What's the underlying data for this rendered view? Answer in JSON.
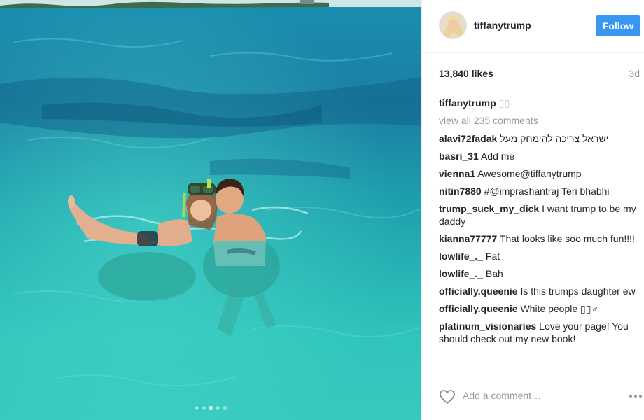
{
  "post": {
    "photo": {
      "alt": "",
      "carousel_dots": 5,
      "active_dot": 3
    }
  },
  "header": {
    "username": "tiffanytrump",
    "follow_label": "Follow"
  },
  "meta": {
    "likes": "13,840 likes",
    "age": "3d"
  },
  "caption": {
    "username": "tiffanytrump",
    "text": "▯▯"
  },
  "view_all_comments": "view all 235 comments",
  "comments": [
    {
      "user": "alavi72fadak",
      "text": "ישראל צריכה להימחק מעל"
    },
    {
      "user": "basri_31",
      "text": "Add me"
    },
    {
      "user": "vienna1",
      "text": "Awesome@tiffanytrump"
    },
    {
      "user": "nitin7880",
      "text": "#@imprashantraj Teri bhabhi"
    },
    {
      "user": "trump_suck_my_dick",
      "text": "I want trump to be my daddy"
    },
    {
      "user": "kianna77777",
      "text": "That looks like soo much fun!!!!"
    },
    {
      "user": "lowlife_._",
      "text": "Fat"
    },
    {
      "user": "lowlife_._",
      "text": "Bah"
    },
    {
      "user": "officially.queenie",
      "text": "Is this trumps daughter ew"
    },
    {
      "user": "officially.queenie",
      "text": "White people ▯▯♂"
    },
    {
      "user": "platinum_visionaries",
      "text": "Love your page! You should check out my new book!"
    }
  ],
  "footer": {
    "add_comment_placeholder": "Add a comment…",
    "like_icon": "heart-icon",
    "more_icon": "more-options-icon"
  },
  "colors": {
    "accent": "#3897f0",
    "muted": "#999999",
    "text": "#262626",
    "water_dark": "#0f6f93",
    "water_light": "#3fd3c8"
  }
}
